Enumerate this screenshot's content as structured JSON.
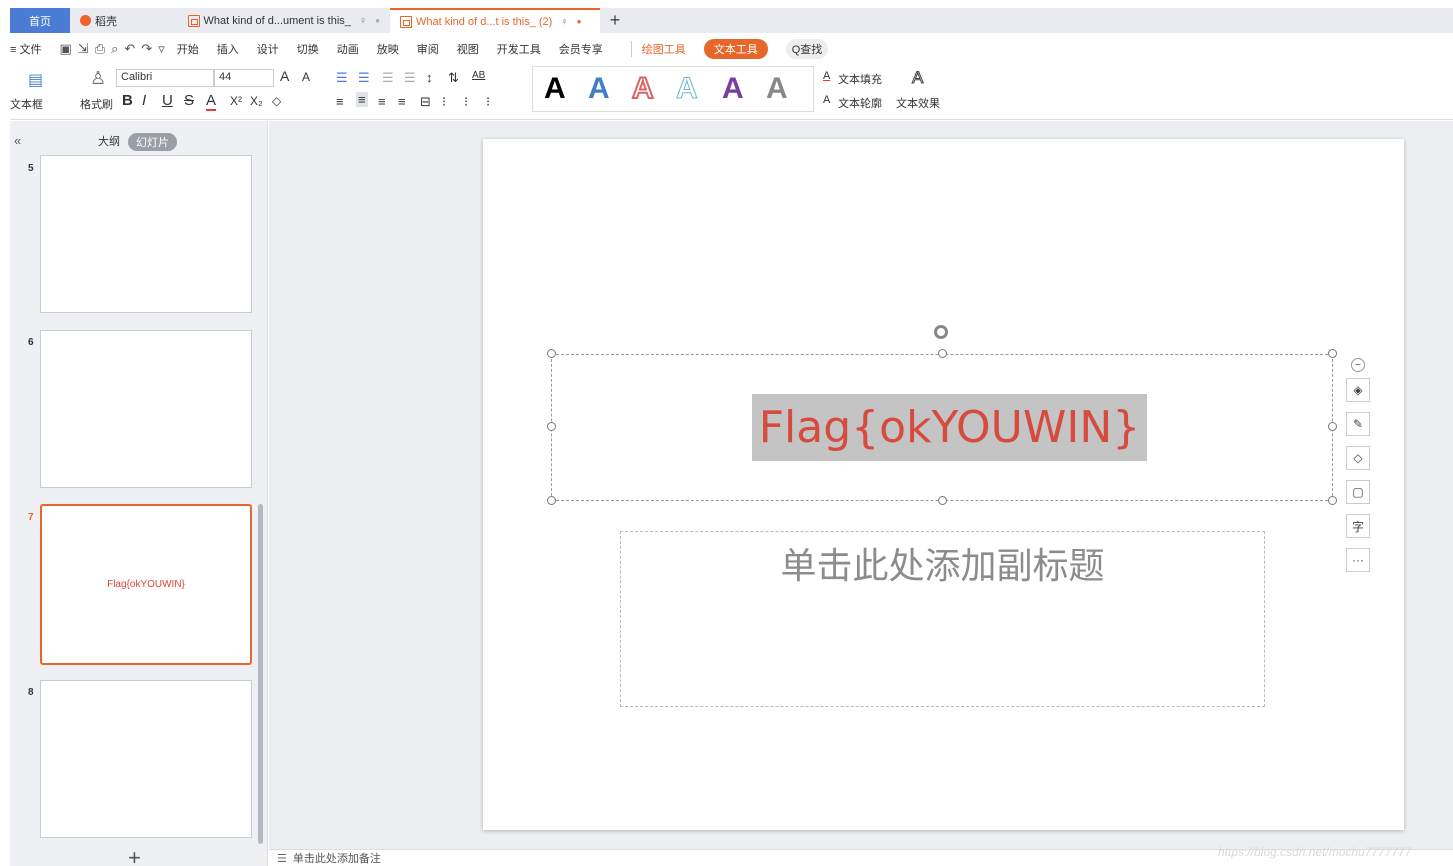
{
  "tabs": {
    "home": "首页",
    "daoke": "稻壳",
    "doc1": "What kind of d...ument is this_",
    "doc2": "What kind of d...t is this_ (2)",
    "add": "+"
  },
  "menu": {
    "file": "≡ 文件",
    "items": [
      "开始",
      "插入",
      "设计",
      "切换",
      "动画",
      "放映",
      "审阅",
      "视图",
      "开发工具",
      "会员专享"
    ],
    "draw_tools": "绘图工具",
    "text_tools": "文本工具",
    "find": "Q查找"
  },
  "ribbon": {
    "textbox": "文本框",
    "format_painter": "格式刷",
    "font_name": "Calibri",
    "font_size": "44",
    "text_fill": "文本填充",
    "text_outline": "文本轮廓",
    "text_effect": "文本效果",
    "bold": "B",
    "italic": "I",
    "underline": "U",
    "strike": "S",
    "fontcolor": "A",
    "big_a": "A",
    "small_a": "A",
    "styles": [
      "A",
      "A",
      "A",
      "A",
      "A",
      "A"
    ]
  },
  "leftpanel": {
    "collapse": "«",
    "outline": "大纲",
    "slides": "幻灯片",
    "thumbs": [
      {
        "num": "5",
        "text": ""
      },
      {
        "num": "6",
        "text": ""
      },
      {
        "num": "7",
        "text": "Flag{okYOUWIN}"
      },
      {
        "num": "8",
        "text": ""
      }
    ],
    "add": "+"
  },
  "slide": {
    "title": "Flag{okYOUWIN}",
    "subtitle": "单击此处添加副标题"
  },
  "float_tools": {
    "minus": "−",
    "char": "字",
    "more": "···"
  },
  "notes": "单击此处添加备注",
  "watermark": "https://blog.csdn.net/mochu7777777",
  "colors": {
    "accent": "#e7672a",
    "home_tab": "#4a7cd6",
    "title_text": "#d64b3d"
  }
}
